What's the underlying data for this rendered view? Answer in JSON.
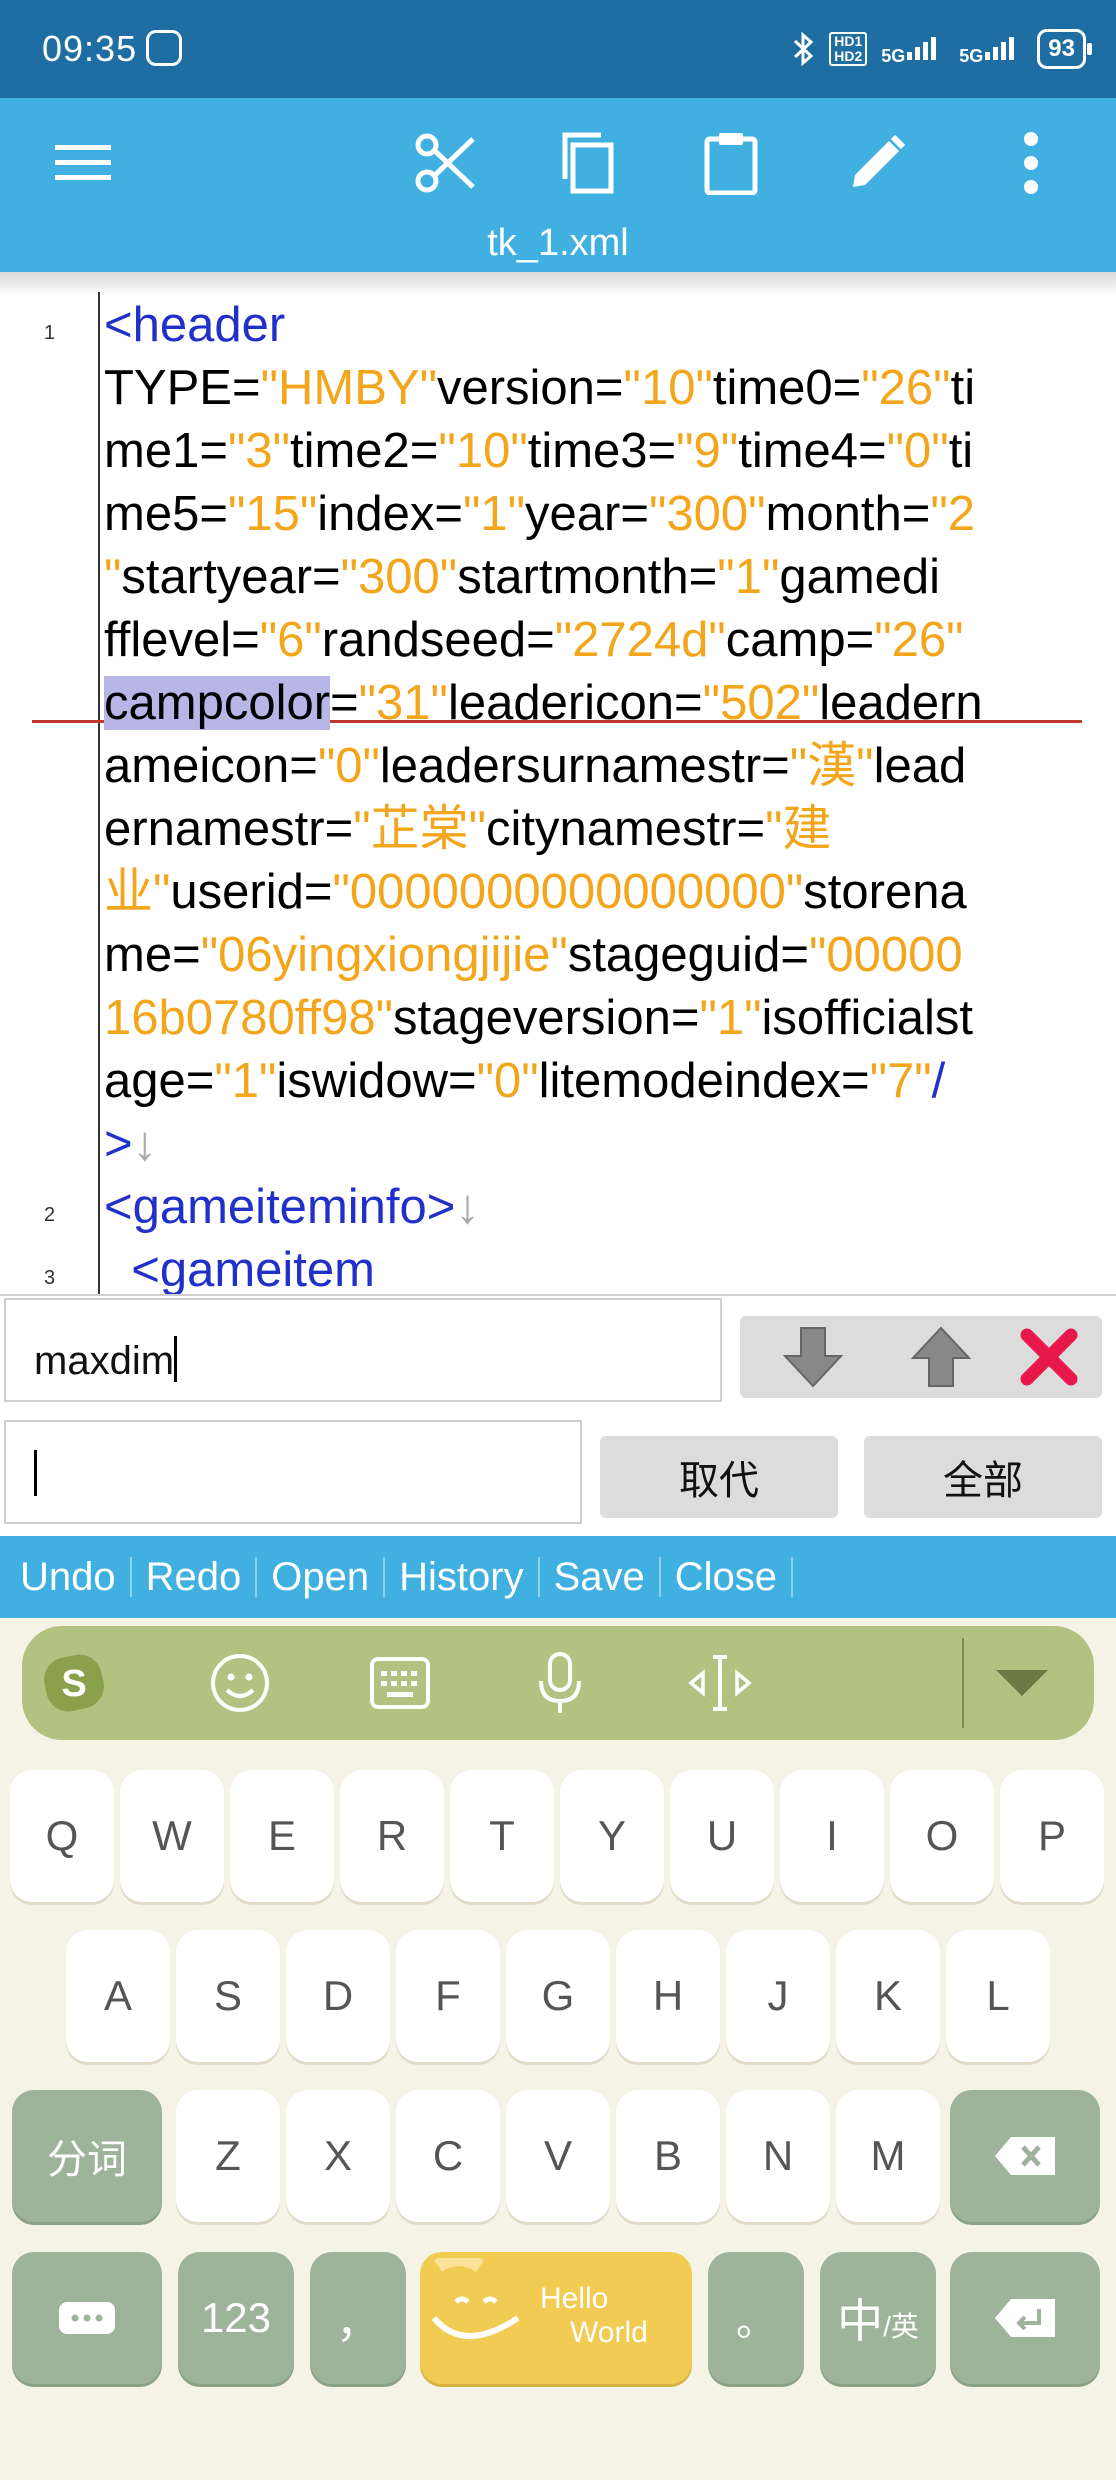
{
  "status_bar": {
    "time": "09:35",
    "hd1": "HD1",
    "hd2": "HD2",
    "sim1": "5G",
    "sim2": "5G",
    "battery": "93"
  },
  "toolbar": {
    "menu_icon": "menu-icon",
    "cut_icon": "scissors-icon",
    "copy_icon": "copy-icon",
    "paste_icon": "clipboard-icon",
    "edit_icon": "pencil-icon",
    "more_icon": "more-vert-icon",
    "filename": "tk_1.xml"
  },
  "editor": {
    "line_numbers": [
      "1",
      "2",
      "3"
    ],
    "lines": [
      [
        {
          "t": "<header",
          "c": "tag"
        }
      ],
      [
        {
          "t": "TYPE="
        },
        {
          "t": "\"HMBY\"",
          "c": "str"
        },
        {
          "t": "version="
        },
        {
          "t": "\"10\"",
          "c": "str"
        },
        {
          "t": "time0="
        },
        {
          "t": "\"26\"",
          "c": "str"
        },
        {
          "t": "ti"
        }
      ],
      [
        {
          "t": "me1="
        },
        {
          "t": "\"3\"",
          "c": "str"
        },
        {
          "t": "time2="
        },
        {
          "t": "\"10\"",
          "c": "str"
        },
        {
          "t": "time3="
        },
        {
          "t": "\"9\"",
          "c": "str"
        },
        {
          "t": "time4="
        },
        {
          "t": "\"0\"",
          "c": "str"
        },
        {
          "t": "ti"
        }
      ],
      [
        {
          "t": "me5="
        },
        {
          "t": "\"15\"",
          "c": "str"
        },
        {
          "t": "index="
        },
        {
          "t": "\"1\"",
          "c": "str"
        },
        {
          "t": "year="
        },
        {
          "t": "\"300\"",
          "c": "str"
        },
        {
          "t": "month="
        },
        {
          "t": "\"2",
          "c": "str"
        }
      ],
      [
        {
          "t": "\"",
          "c": "str"
        },
        {
          "t": "startyear="
        },
        {
          "t": "\"300\"",
          "c": "str"
        },
        {
          "t": "startmonth="
        },
        {
          "t": "\"1\"",
          "c": "str"
        },
        {
          "t": "gamedi"
        }
      ],
      [
        {
          "t": "fflevel="
        },
        {
          "t": "\"6\"",
          "c": "str"
        },
        {
          "t": "randseed="
        },
        {
          "t": "\"2724d\"",
          "c": "str"
        },
        {
          "t": "camp="
        },
        {
          "t": "\"26\"",
          "c": "str"
        }
      ],
      [
        {
          "t": "campcolor",
          "c": "sel"
        },
        {
          "t": "="
        },
        {
          "t": "\"31\"",
          "c": "str"
        },
        {
          "t": "leadericon="
        },
        {
          "t": "\"502\"",
          "c": "str"
        },
        {
          "t": "leadern"
        }
      ],
      [
        {
          "t": "ameicon="
        },
        {
          "t": "\"0\"",
          "c": "str"
        },
        {
          "t": "leadersurnamestr="
        },
        {
          "t": "\"漢\"",
          "c": "str"
        },
        {
          "t": "lead"
        }
      ],
      [
        {
          "t": "ernamestr="
        },
        {
          "t": "\"芷棠\"",
          "c": "str"
        },
        {
          "t": "citynamestr="
        },
        {
          "t": "\"建",
          "c": "str"
        }
      ],
      [
        {
          "t": "业\"",
          "c": "str"
        },
        {
          "t": "userid="
        },
        {
          "t": "\"0000000000000000\"",
          "c": "str"
        },
        {
          "t": "storena"
        }
      ],
      [
        {
          "t": "me="
        },
        {
          "t": "\"06yingxiongjijie\"",
          "c": "str"
        },
        {
          "t": "stageguid="
        },
        {
          "t": "\"00000",
          "c": "str"
        }
      ],
      [
        {
          "t": "16b0780ff98\"",
          "c": "str"
        },
        {
          "t": "stageversion="
        },
        {
          "t": "\"1\"",
          "c": "str"
        },
        {
          "t": "isofficialst"
        }
      ],
      [
        {
          "t": "age="
        },
        {
          "t": "\"1\"",
          "c": "str"
        },
        {
          "t": "iswidow="
        },
        {
          "t": "\"0\"",
          "c": "str"
        },
        {
          "t": "litemodeindex="
        },
        {
          "t": "\"7\"",
          "c": "str"
        },
        {
          "t": "/",
          "c": "tag"
        }
      ],
      [
        {
          "t": ">",
          "c": "tag"
        },
        {
          "t": "↓",
          "c": "arrow"
        }
      ],
      [
        {
          "t": "<gameiteminfo>",
          "c": "tag"
        },
        {
          "t": "↓",
          "c": "arrow"
        }
      ],
      [
        {
          "t": "  <gameitem",
          "c": "tag"
        }
      ]
    ]
  },
  "find_panel": {
    "find_value": "maxdim",
    "replace_value": "",
    "down_icon": "arrow-down-icon",
    "up_icon": "arrow-up-icon",
    "close_icon": "close-x-icon",
    "replace_label": "取代",
    "replace_all_label": "全部"
  },
  "actions": [
    "Undo",
    "Redo",
    "Open",
    "History",
    "Save",
    "Close"
  ],
  "keyboard": {
    "tools": [
      "sogou-logo-icon",
      "emoji-icon",
      "keyboard-icon",
      "microphone-icon",
      "cursor-move-icon",
      "collapse-keyboard-icon"
    ],
    "row1": [
      "Q",
      "W",
      "E",
      "R",
      "T",
      "Y",
      "U",
      "I",
      "O",
      "P"
    ],
    "row2": [
      "A",
      "S",
      "D",
      "F",
      "G",
      "H",
      "J",
      "K",
      "L"
    ],
    "row3_left": "分词",
    "row3": [
      "Z",
      "X",
      "C",
      "V",
      "B",
      "N",
      "M"
    ],
    "row3_right_icon": "backspace-icon",
    "row4": {
      "dots_icon": "ellipsis-icon",
      "num": "123",
      "comma": "，",
      "space_line1": "Hello",
      "space_line2": "World",
      "period": "。",
      "lang_main": "中",
      "lang_sub": "/英",
      "enter_icon": "enter-icon"
    }
  }
}
